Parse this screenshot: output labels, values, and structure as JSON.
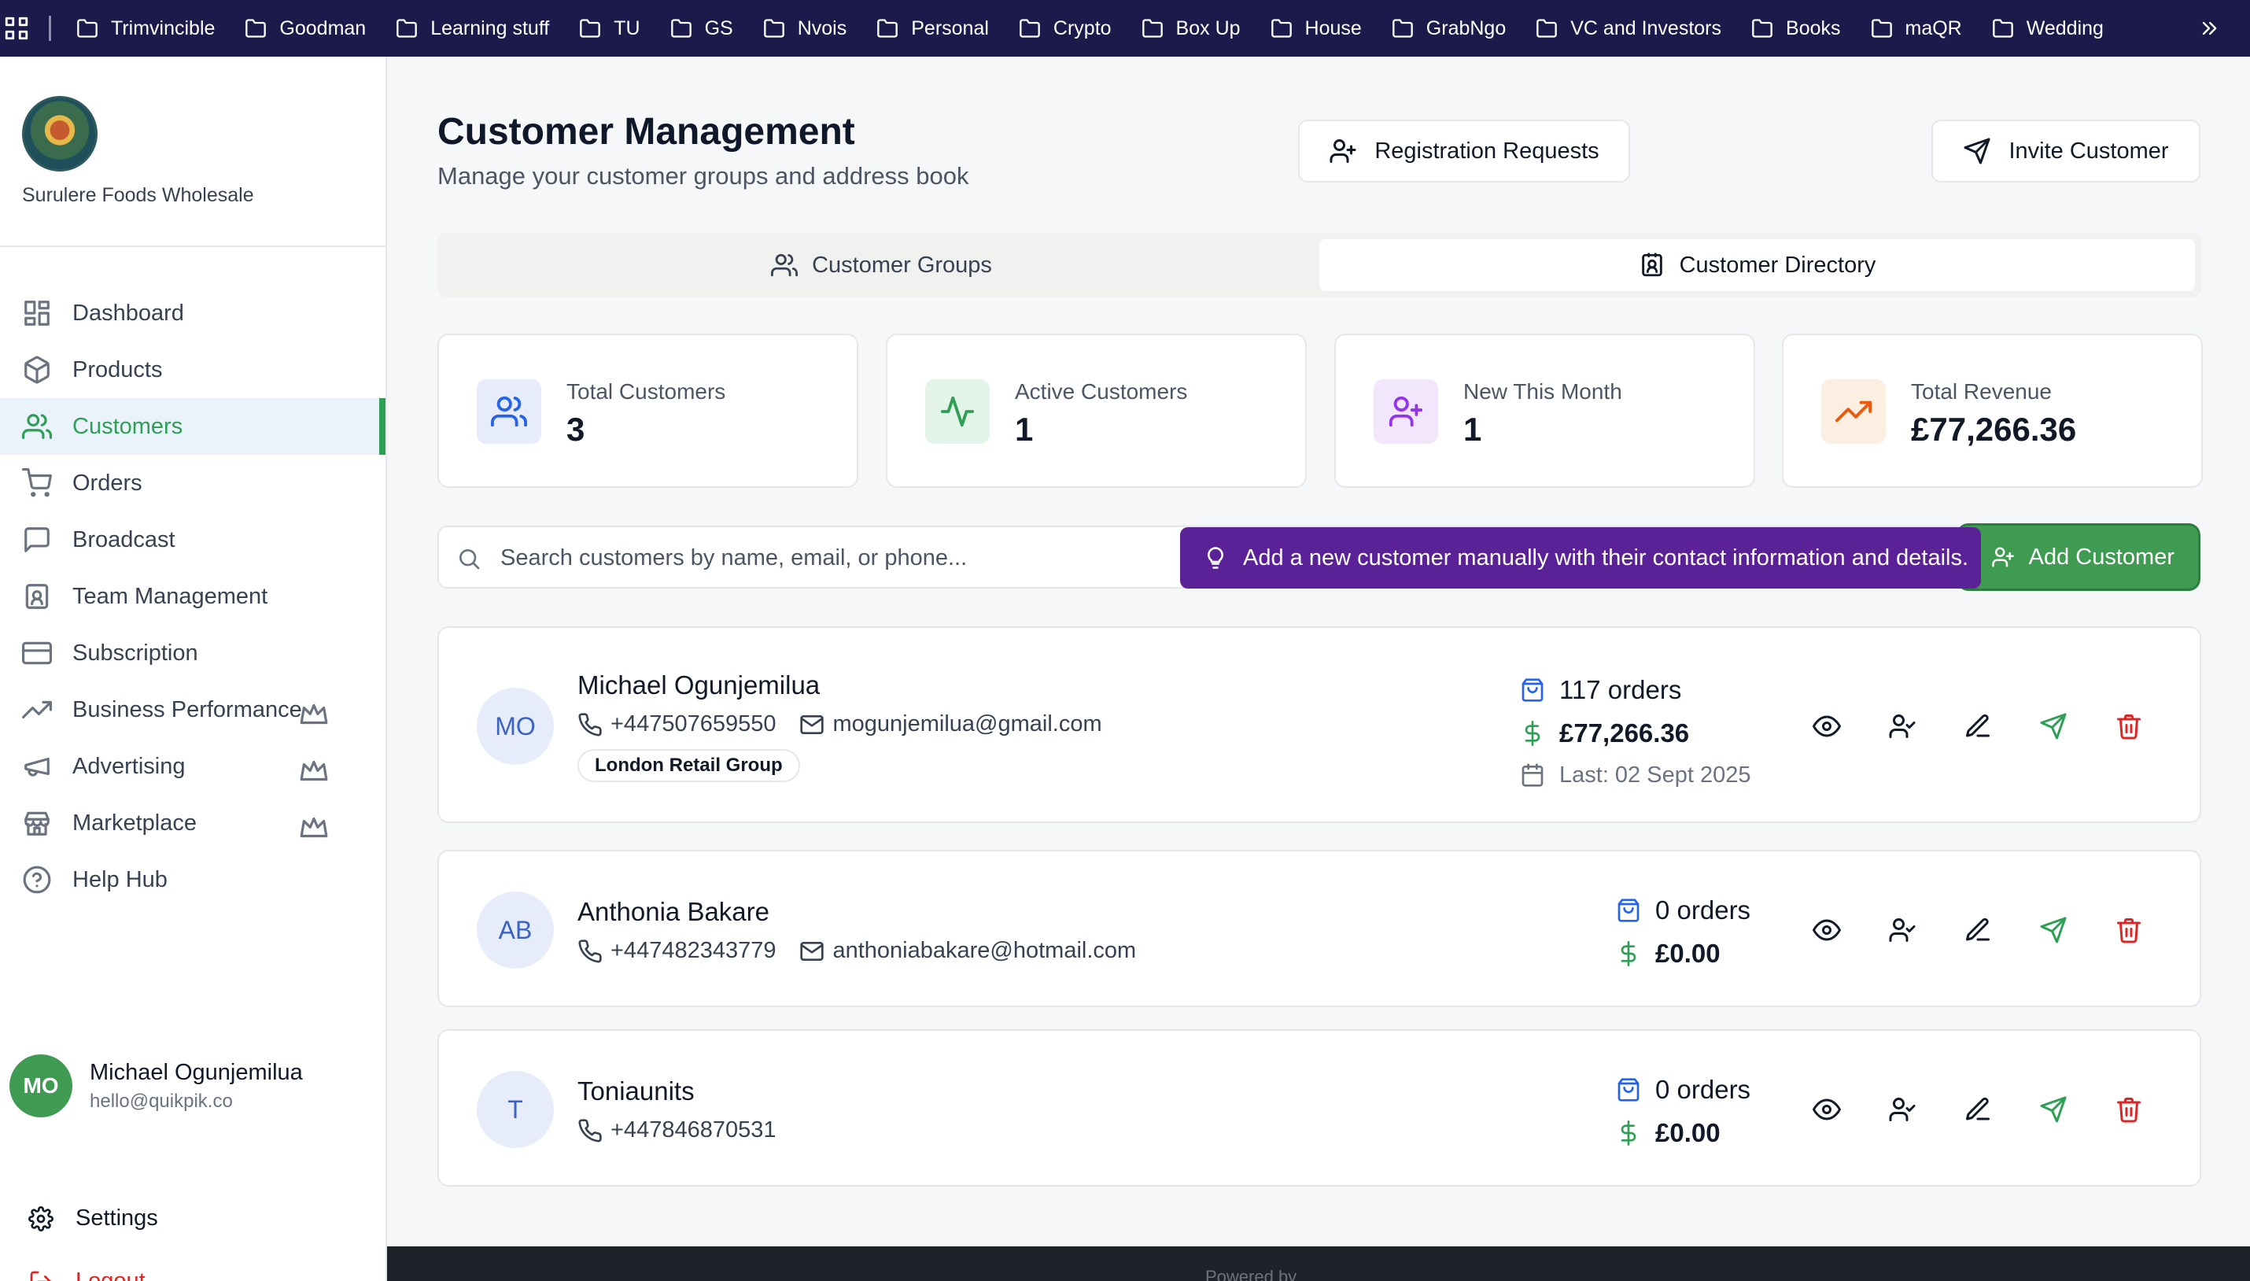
{
  "bookmarks": {
    "items": [
      "Trimvincible",
      "Goodman",
      "Learning stuff",
      "TU",
      "GS",
      "Nvois",
      "Personal",
      "Crypto",
      "Box Up",
      "House",
      "GrabNgo",
      "VC and Investors",
      "Books",
      "maQR",
      "Wedding"
    ],
    "icons": {
      "apps": "apps-grid-icon",
      "folder": "folder-icon",
      "more": "chevrons-right-icon"
    }
  },
  "sidebar": {
    "business_name": "Surulere Foods Wholesale",
    "nav": [
      {
        "label": "Dashboard",
        "icon": "dashboard-icon"
      },
      {
        "label": "Products",
        "icon": "box-icon"
      },
      {
        "label": "Customers",
        "icon": "users-icon",
        "active": true
      },
      {
        "label": "Orders",
        "icon": "cart-icon"
      },
      {
        "label": "Broadcast",
        "icon": "message-icon"
      },
      {
        "label": "Team Management",
        "icon": "id-badge-icon"
      },
      {
        "label": "Subscription",
        "icon": "credit-card-icon"
      },
      {
        "label": "Business Performance",
        "icon": "trending-up-icon",
        "premium": true
      },
      {
        "label": "Advertising",
        "icon": "megaphone-icon",
        "premium": true
      },
      {
        "label": "Marketplace",
        "icon": "store-icon",
        "premium": true
      },
      {
        "label": "Help Hub",
        "icon": "help-circle-icon"
      }
    ],
    "user": {
      "initials": "MO",
      "name": "Michael Ogunjemilua",
      "email": "hello@quikpik.co"
    },
    "settings_label": "Settings",
    "logout_label": "Logout"
  },
  "header": {
    "title": "Customer Management",
    "subtitle": "Manage your customer groups and address book",
    "registration_label": "Registration Requests",
    "invite_label": "Invite Customer"
  },
  "tabs": [
    {
      "label": "Customer Groups",
      "icon": "users-icon"
    },
    {
      "label": "Customer Directory",
      "icon": "contact-icon",
      "active": true
    }
  ],
  "stats": [
    {
      "label": "Total Customers",
      "value": "3",
      "icon": "users-icon",
      "color": "#2563eb",
      "bg": "#e6ecfa"
    },
    {
      "label": "Active Customers",
      "value": "1",
      "icon": "activity-icon",
      "color": "#2f9f56",
      "bg": "#e3f4e8"
    },
    {
      "label": "New This Month",
      "value": "1",
      "icon": "user-plus-icon",
      "color": "#9333ea",
      "bg": "#f1e6fb"
    },
    {
      "label": "Total Revenue",
      "value": "£77,266.36",
      "icon": "trending-up-icon",
      "color": "#ea580c",
      "bg": "#fdeee2"
    }
  ],
  "search": {
    "placeholder": "Search customers by name, email, or phone..."
  },
  "add_customer_label": "Add Customer",
  "tooltip": "Add a new customer manually with their contact information and details.",
  "customers": [
    {
      "initials": "MO",
      "name": "Michael Ogunjemilua",
      "phone": "+447507659550",
      "email": "mogunjemilua@gmail.com",
      "group": "London Retail Group",
      "orders": "117 orders",
      "revenue": "£77,266.36",
      "last_order": "Last: 02 Sept 2025"
    },
    {
      "initials": "AB",
      "name": "Anthonia Bakare",
      "phone": "+447482343779",
      "email": "anthoniabakare@hotmail.com",
      "orders": "0 orders",
      "revenue": "£0.00"
    },
    {
      "initials": "T",
      "name": "Toniaunits",
      "phone": "+447846870531",
      "orders": "0 orders",
      "revenue": "£0.00"
    }
  ],
  "footer": {
    "text": "Powered by"
  }
}
